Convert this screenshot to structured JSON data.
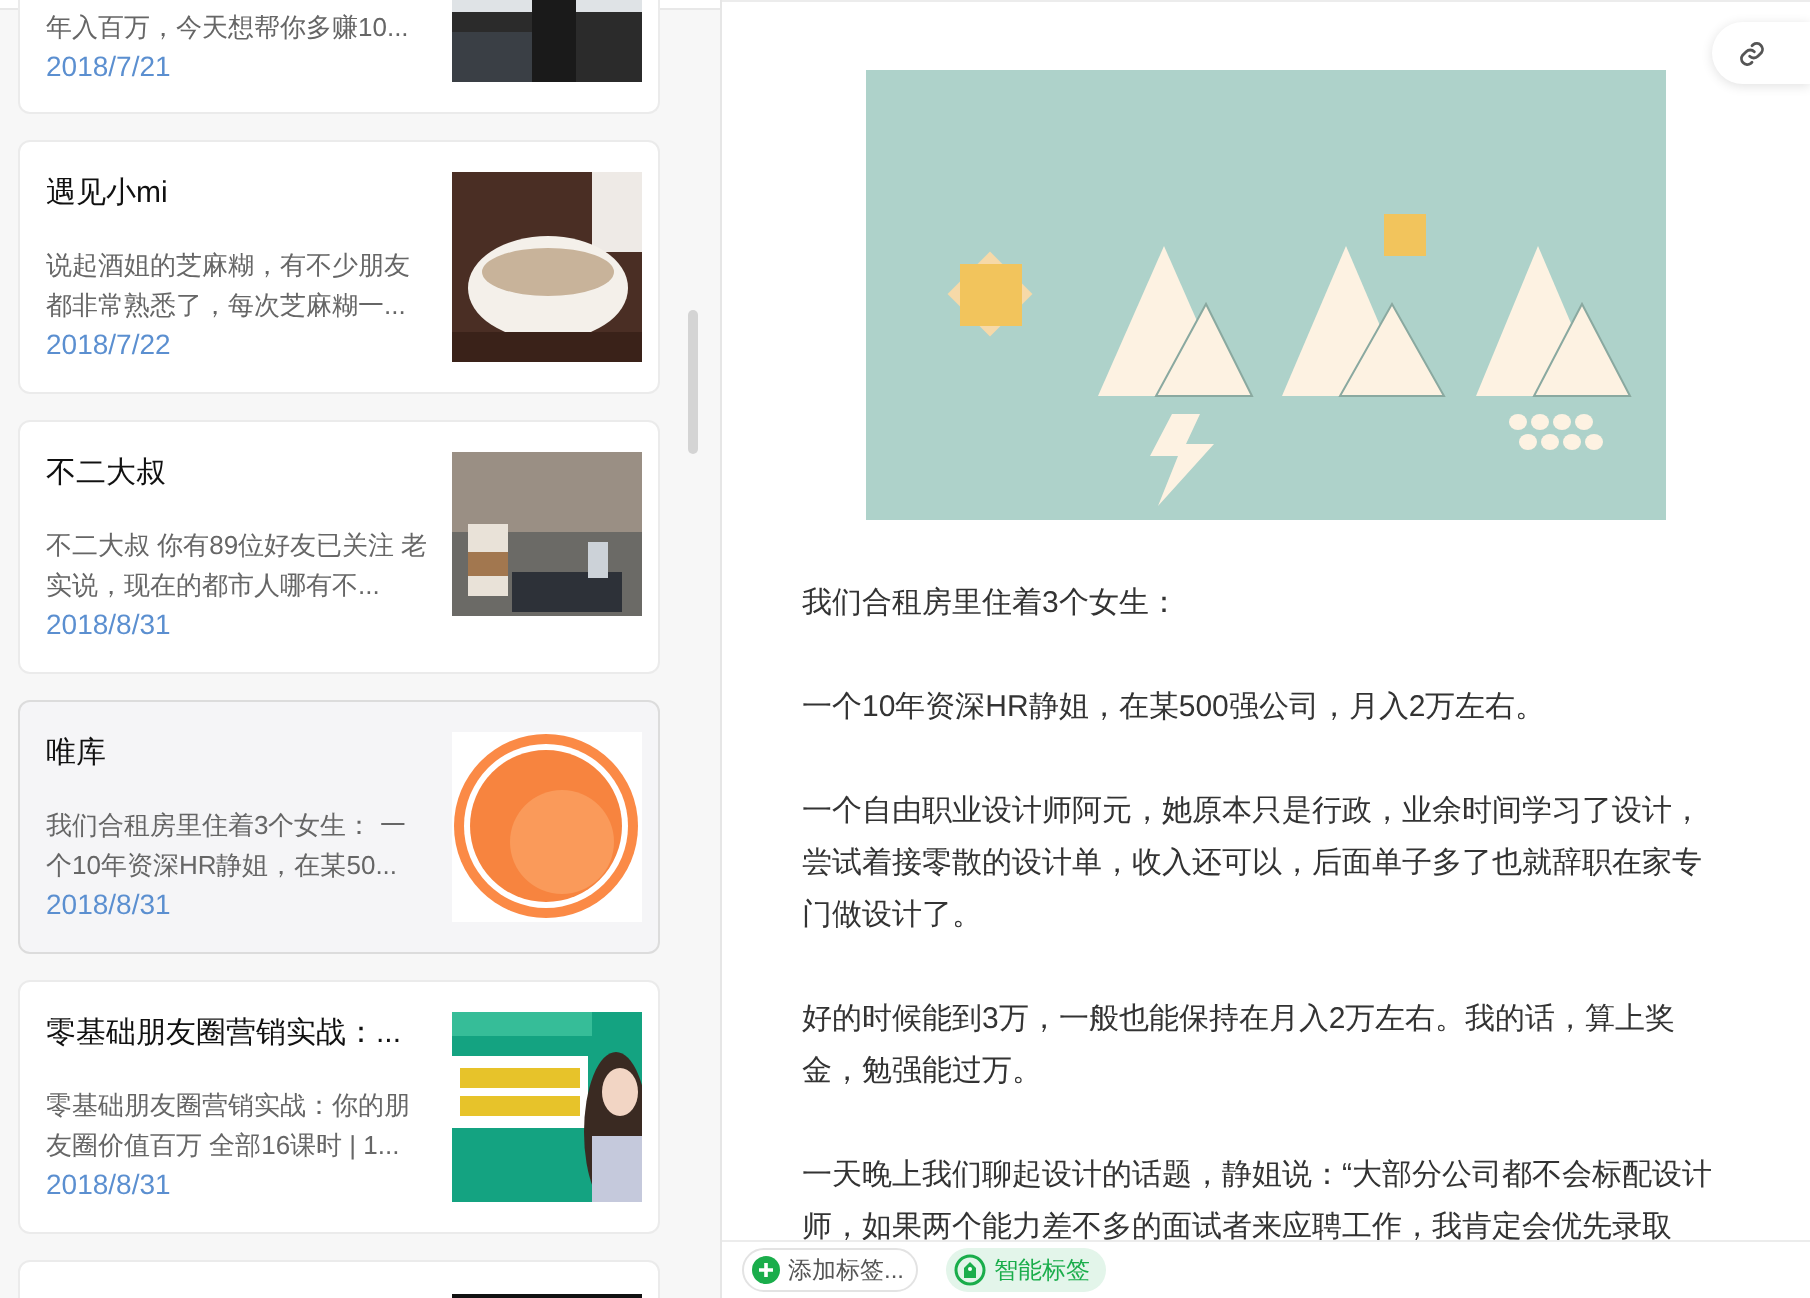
{
  "article_list": [
    {
      "kind": "partial",
      "summary": "年入百万，今天想帮你多赚10...",
      "date": "2018/7/21",
      "selected": false
    },
    {
      "kind": "full",
      "title": "遇见小mi",
      "summary": "说起酒姐的芝麻糊，有不少朋友都非常熟悉了，每次芝麻糊一...",
      "date": "2018/7/22",
      "selected": false
    },
    {
      "kind": "full",
      "title": "不二大叔",
      "summary": "不二大叔 你有89位好友已关注 老实说，现在的都市人哪有不...",
      "date": "2018/8/31",
      "selected": false
    },
    {
      "kind": "full",
      "title": "唯库",
      "summary": "我们合租房里住着3个女生： 一个10年资深HR静姐，在某50...",
      "date": "2018/8/31",
      "selected": true
    },
    {
      "kind": "full",
      "title": "零基础朋友圈营销实战：...",
      "summary": "零基础朋友圈营销实战：你的朋友圈价值百万 全部16课时 | 1...",
      "date": "2018/8/31",
      "selected": false
    },
    {
      "kind": "stub",
      "selected": false
    }
  ],
  "article": {
    "paragraphs": [
      "我们合租房里住着3个女生：",
      "一个10年资深HR静姐，在某500强公司，月入2万左右。",
      "一个自由职业设计师阿元，她原本只是行政，业余时间学习了设计，尝试着接零散的设计单，收入还可以，后面单子多了也就辞职在家专门做设计了。",
      "好的时候能到3万，一般也能保持在月入2万左右。我的话，算上奖金，勉强能过万。",
      "一天晚上我们聊起设计的话题，静姐说：“大部分公司都不会标配设计师，如果两个能力差不多的面试者来应聘工作，我肯定会优先录取"
    ]
  },
  "footer": {
    "tags": [
      {
        "kind": "add",
        "label": "添加标签..."
      },
      {
        "kind": "smart",
        "label": "智能标签"
      }
    ]
  }
}
